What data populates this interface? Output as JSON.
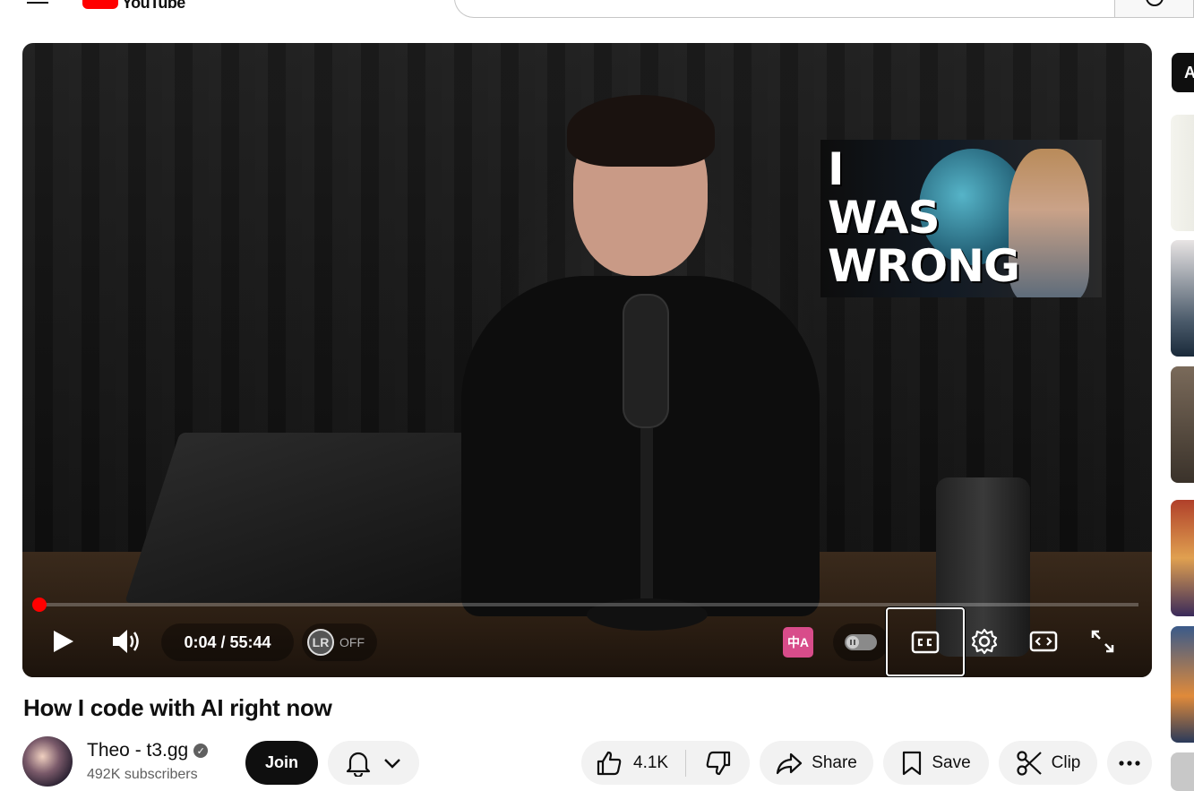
{
  "header": {
    "logo_text": "YouTube"
  },
  "player": {
    "inset_text_lines": [
      "I",
      "WAS",
      "WRONG"
    ],
    "time_display": "0:04 / 55:44",
    "progress_fraction": 0.0012,
    "lr_badge": "LR",
    "lr_state": "OFF",
    "translate_glyph": "中A"
  },
  "video": {
    "title": "How I code with AI right now"
  },
  "channel": {
    "name": "Theo - t3.gg",
    "subscribers": "492K subscribers",
    "join_label": "Join"
  },
  "actions": {
    "like_count": "4.1K",
    "share_label": "Share",
    "save_label": "Save",
    "clip_label": "Clip"
  },
  "sidebar": {
    "chip_label": "A"
  },
  "colors": {
    "accent": "#ff0000",
    "translate": "#d84c8a"
  }
}
